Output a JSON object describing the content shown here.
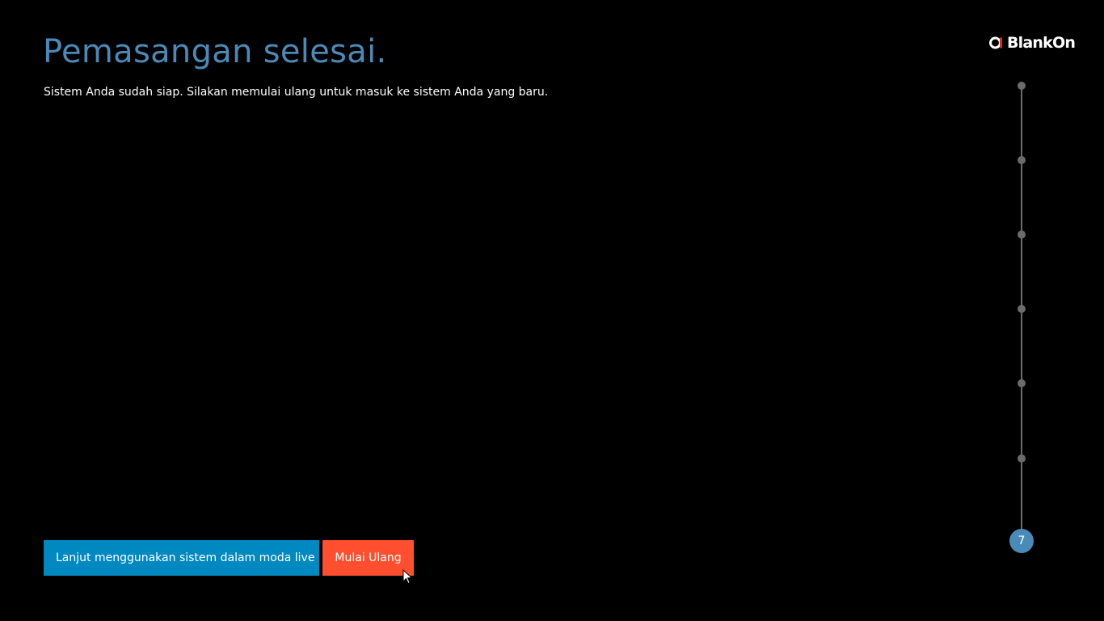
{
  "header": {
    "title": "Pemasangan selesai.",
    "description": "Sistem Anda sudah siap. Silakan memulai ulang untuk masuk ke sistem Anda yang baru."
  },
  "brand": {
    "logo_text": "BlankOn",
    "accent_color": "#e0261f"
  },
  "progress": {
    "current_step": "7",
    "total_steps": 7,
    "active_color": "#4a8ab8",
    "inactive_color": "#6b6b6b"
  },
  "actions": {
    "live_label": "Lanjut menggunakan sistem dalam moda live",
    "live_color": "#0088c0",
    "restart_label": "Mulai Ulang",
    "restart_color": "#ff4f2f"
  }
}
